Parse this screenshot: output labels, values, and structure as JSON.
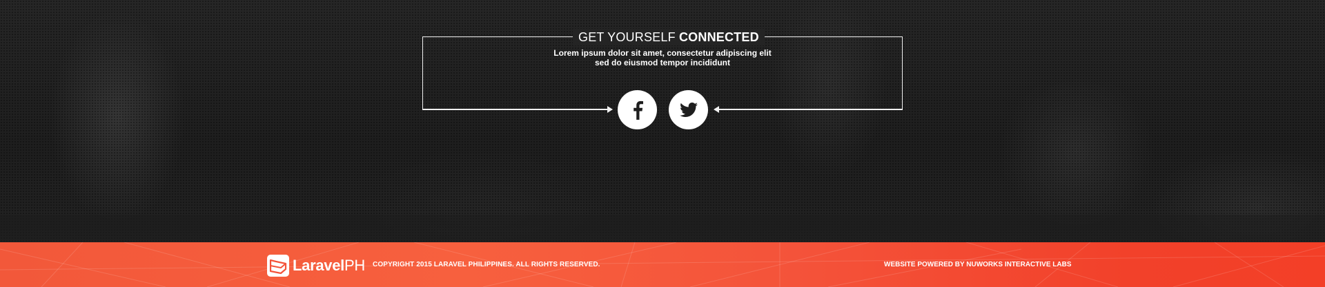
{
  "connect": {
    "heading_light": "GET YOURSELF",
    "heading_bold": "CONNECTED",
    "subtitle_line1": "Lorem ipsum dolor sit amet, consectetur adipiscing elit",
    "subtitle_line2": "sed do eiusmod tempor incididunt",
    "social": [
      {
        "icon": "facebook-icon",
        "label": "Facebook"
      },
      {
        "icon": "twitter-icon",
        "label": "Twitter"
      }
    ]
  },
  "footer": {
    "logo_text": "Laravel",
    "logo_suffix": "PH",
    "copyright": "COPYRIGHT 2015 LARAVEL PHILIPPINES. ALL RIGHTS RESERVED.",
    "powered_by": "WEBSITE POWERED BY NUWORKS INTERACTIVE LABS"
  },
  "colors": {
    "footer_accent": "#f4533a",
    "text": "#ffffff",
    "background": "#1c1c1c"
  }
}
